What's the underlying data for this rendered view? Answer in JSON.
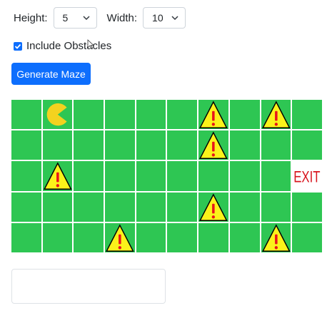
{
  "controls": {
    "height_label": "Height:",
    "height_value": "5",
    "width_label": "Width:",
    "width_value": "10",
    "obstacles_label": "Include Obstacles",
    "obstacles_checked": true,
    "generate_label": "Generate Maze"
  },
  "maze": {
    "rows": 5,
    "cols": 10,
    "cell_color": "#2ec653",
    "exit_label": "EXIT",
    "cells": [
      [
        "empty",
        "pacman",
        "empty",
        "empty",
        "empty",
        "empty",
        "warning",
        "empty",
        "warning",
        "empty"
      ],
      [
        "empty",
        "empty",
        "empty",
        "empty",
        "empty",
        "empty",
        "warning",
        "empty",
        "empty",
        "empty"
      ],
      [
        "empty",
        "warning",
        "empty",
        "empty",
        "empty",
        "empty",
        "empty",
        "empty",
        "empty",
        "exit"
      ],
      [
        "empty",
        "empty",
        "empty",
        "empty",
        "empty",
        "empty",
        "warning",
        "empty",
        "empty",
        "empty"
      ],
      [
        "empty",
        "empty",
        "empty",
        "warning",
        "empty",
        "empty",
        "empty",
        "empty",
        "warning",
        "empty"
      ]
    ]
  },
  "colors": {
    "accent": "#0d6efd",
    "pacman": "#f3d21f",
    "warning_fill": "#fbf21a",
    "warning_mark": "#e8131c",
    "exit_text": "#d8141d"
  },
  "output": {
    "value": ""
  }
}
